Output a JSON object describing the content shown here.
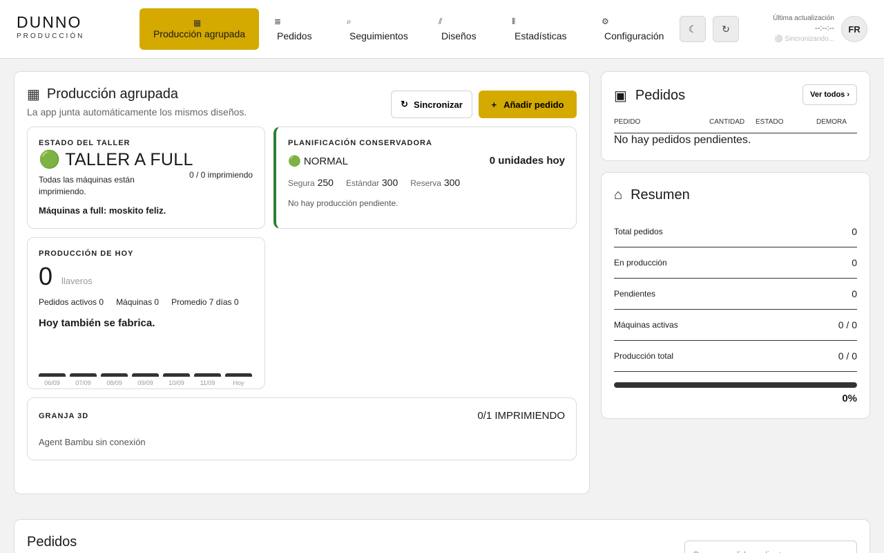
{
  "brand": {
    "name": "DUNNO",
    "subtitle": "PRODUCCIÓN"
  },
  "nav": [
    {
      "icon": "grid-icon",
      "glyph": "▦",
      "label": "Producción agrupada",
      "active": true
    },
    {
      "icon": "list-icon",
      "glyph": "≣",
      "label": "Pedidos"
    },
    {
      "icon": "search-icon",
      "glyph": "⌕",
      "label": "Seguimientos"
    },
    {
      "icon": "hatch-icon",
      "glyph": "⫽",
      "label": "Diseños"
    },
    {
      "icon": "chart-icon",
      "glyph": "⦀",
      "label": "Estadísticas"
    },
    {
      "icon": "gear-icon",
      "glyph": "⚙",
      "label": "Configuración"
    }
  ],
  "toolbar": {
    "theme_glyph": "☾",
    "refresh_glyph": "↻"
  },
  "status_bar": {
    "label": "Última actualización",
    "time": "--:--:--",
    "sync": "⚪ Sincronizando..."
  },
  "user": {
    "initials": "FR"
  },
  "main": {
    "title_glyph": "▦",
    "title": "Producción agrupada",
    "subtitle": "La app junta automáticamente los mismos diseños.",
    "sync_glyph": "↻",
    "sync_label": "Sincronizar",
    "add_glyph": "+",
    "add_label": "Añadir pedido",
    "workshop": {
      "kicker": "ESTADO DEL TALLER",
      "status": "🟢 TALLER A FULL",
      "desc": "Todas las máquinas están imprimiendo.",
      "count": "0 / 0 imprimiendo",
      "footer": "Máquinas a full: moskito feliz."
    },
    "planning": {
      "kicker": "PLANIFICACIÓN CONSERVADORA",
      "level": "🟢 NORMAL",
      "units": "0 unidades hoy",
      "safe_label": "Segura",
      "safe_value": "250",
      "std_label": "Estándar",
      "std_value": "300",
      "res_label": "Reserva",
      "res_value": "300",
      "note": "No hay producción pendiente."
    },
    "today": {
      "kicker": "PRODUCCIÓN DE HOY",
      "value": "0",
      "unit": "llaveros",
      "active_orders": "Pedidos activos 0",
      "machines": "Máquinas 0",
      "avg7": "Promedio 7 días 0",
      "headline": "Hoy también se fabrica.",
      "days": [
        "06/09",
        "07/09",
        "08/09",
        "09/09",
        "10/09",
        "11/09",
        "Hoy"
      ],
      "daily_values": [
        0,
        0,
        0,
        0,
        0,
        0,
        0
      ]
    },
    "farm": {
      "kicker": "GRANJA 3D",
      "status": "0/1 IMPRIMIENDO",
      "note": "Agent Bambu sin conexión"
    }
  },
  "orders_panel": {
    "glyph": "▣",
    "title": "Pedidos",
    "view_all": "Ver todos ›",
    "columns": [
      "PEDIDO",
      "CANTIDAD",
      "ESTADO",
      "DEMORA"
    ],
    "empty": "No hay pedidos pendientes."
  },
  "summary": {
    "glyph": "⌂",
    "title": "Resumen",
    "rows": [
      {
        "label": "Total pedidos",
        "value": "0"
      },
      {
        "label": "En producción",
        "value": "0"
      },
      {
        "label": "Pendientes",
        "value": "0"
      },
      {
        "label": "Máquinas activas",
        "value": "0 / 0"
      },
      {
        "label": "Producción total",
        "value": "0 / 0"
      }
    ],
    "progress": 0,
    "progress_label": "0%"
  },
  "orders_section": {
    "title": "Pedidos",
    "search_placeholder": "Buscar pedido o cliente..."
  },
  "colors": {
    "accent": "#d4a900",
    "planning_border": "#2e7d32"
  }
}
